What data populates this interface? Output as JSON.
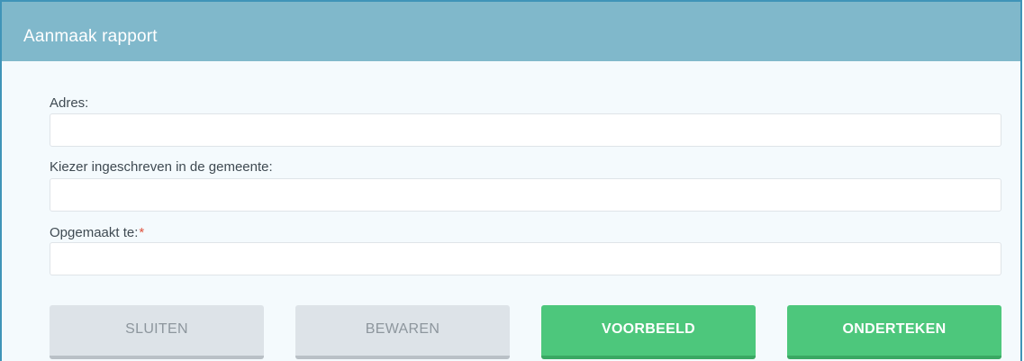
{
  "dialog": {
    "title": "Aanmaak rapport"
  },
  "form": {
    "fields": [
      {
        "label": "Adres:",
        "value": "",
        "placeholder": "",
        "required": false
      },
      {
        "label": "Kiezer ingeschreven in de gemeente:",
        "value": "",
        "placeholder": "",
        "required": false
      },
      {
        "label": "Opgemaakt te:",
        "value": "",
        "placeholder": "",
        "required": true,
        "required_marker": "*"
      }
    ]
  },
  "actions": {
    "close_label": "SLUITEN",
    "save_label": "BEWAREN",
    "preview_label": "VOORBEELD",
    "sign_label": "ONDERTEKEN"
  },
  "colors": {
    "header_bg": "#80b8cb",
    "border": "#3f94b8",
    "primary_green": "#4dc77c",
    "secondary_grey": "#dde3e8",
    "required": "#e0533f"
  }
}
